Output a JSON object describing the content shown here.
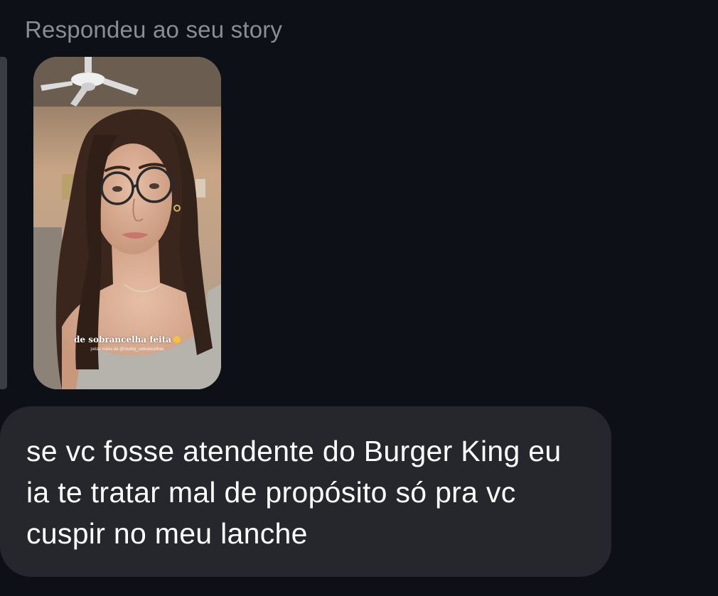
{
  "reply_context": {
    "label": "Respondeu ao seu story"
  },
  "story": {
    "caption": "de sobrancelha feita",
    "caption_emoji": "relieved-face-emoji",
    "subcaption": "pelas mãos da @studioj_sobrancelhas",
    "image_alt": "story-photo-woman-with-glasses"
  },
  "message": {
    "text": "se vc fosse atendente do Burger King eu ia te tratar mal de propósito só pra vc cuspir no meu lanche"
  },
  "colors": {
    "background": "#0d1016",
    "bubble": "#25272d",
    "label_text": "#8a8d93",
    "message_text": "#ffffff",
    "quote_bar": "#3a3d43"
  }
}
